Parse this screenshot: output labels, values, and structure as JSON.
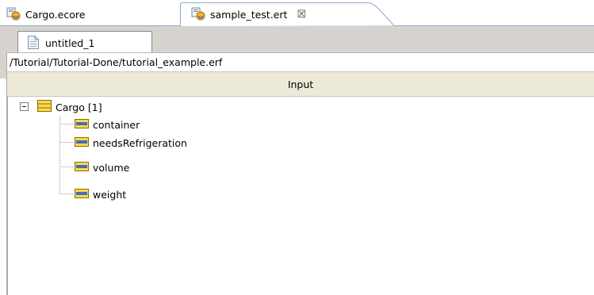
{
  "editor_tabs": [
    {
      "label": "Cargo.ecore",
      "icon": "ecore-model-icon",
      "active": false
    },
    {
      "label": "sample_test.ert",
      "icon": "ert-file-icon",
      "active": true,
      "close_glyph": "☒"
    }
  ],
  "page_tab": {
    "label": "untitled_1",
    "icon": "document-icon"
  },
  "path": "/Tutorial/Tutorial-Done/tutorial_example.erf",
  "column_header": "Input",
  "tree": {
    "root": {
      "label": "Cargo [1]",
      "expanded": true,
      "icon": "eclass-icon"
    },
    "children": [
      {
        "label": "container",
        "icon": "eattribute-icon"
      },
      {
        "label": "needsRefrigeration",
        "icon": "eattribute-icon"
      },
      {
        "label": "volume",
        "icon": "eattribute-icon"
      },
      {
        "label": "weight",
        "icon": "eattribute-icon"
      }
    ]
  },
  "colors": {
    "header_bg": "#ece9d8",
    "page_tab_bg": "#d6d3ce",
    "tab_border": "#8fa8c8"
  }
}
